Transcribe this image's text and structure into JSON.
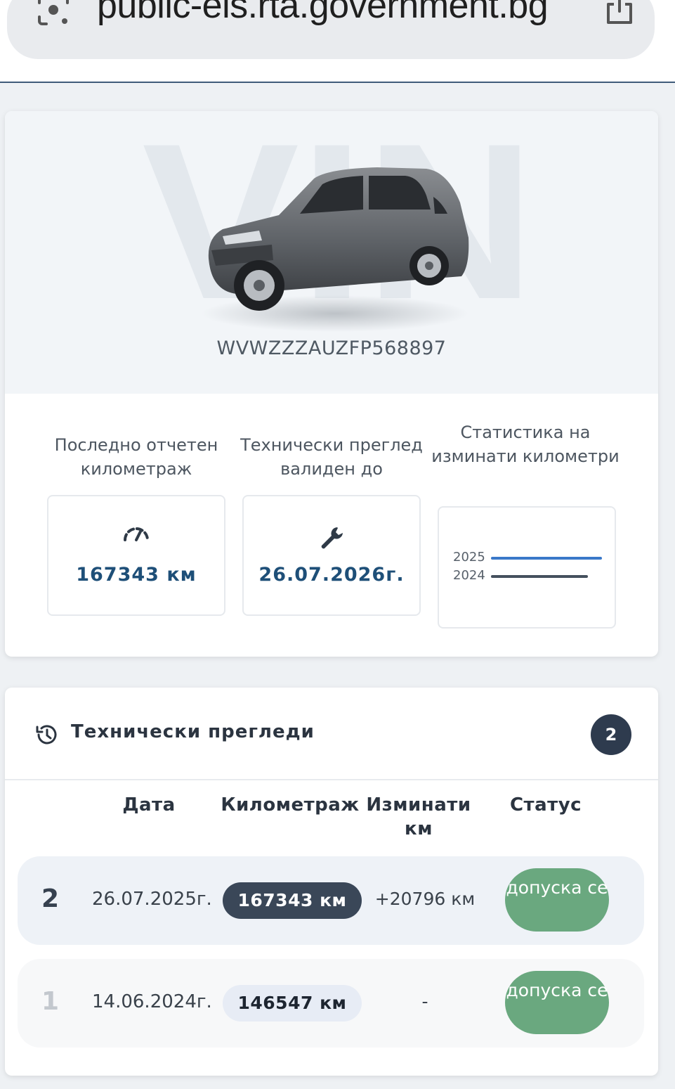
{
  "browser": {
    "url": "public-eis.rta.government.bg"
  },
  "vehicle": {
    "watermark": "VIN",
    "vin": "WVWZZZAUZFP568897"
  },
  "stats": {
    "mileage_label": "Последно отчетен километраж",
    "mileage_value": "167343 км",
    "inspection_label": "Технически преглед валиден до",
    "inspection_value": "26.07.2026г.",
    "statistics_label": "Статистика на изминати километри",
    "statistics_years": [
      {
        "year": "2025",
        "color": "#3a78c9"
      },
      {
        "year": "2024",
        "color": "#45505e"
      }
    ]
  },
  "inspections": {
    "title": "Технически прегледи",
    "count": "2",
    "columns": {
      "date": "Дата",
      "mileage": "Километраж",
      "traveled": "Изминати км",
      "status": "Статус"
    },
    "rows": [
      {
        "num": "2",
        "date": "26.07.2025г.",
        "mileage": "167343 км",
        "traveled": "+20796 км",
        "status": "допуска се"
      },
      {
        "num": "1",
        "date": "14.06.2024г.",
        "mileage": "146547 км",
        "traveled": "-",
        "status": "допуска се"
      }
    ]
  },
  "colors": {
    "accent": "#1e4f78",
    "status_ok": "#6aa87f",
    "badge": "#2e3b4e"
  }
}
